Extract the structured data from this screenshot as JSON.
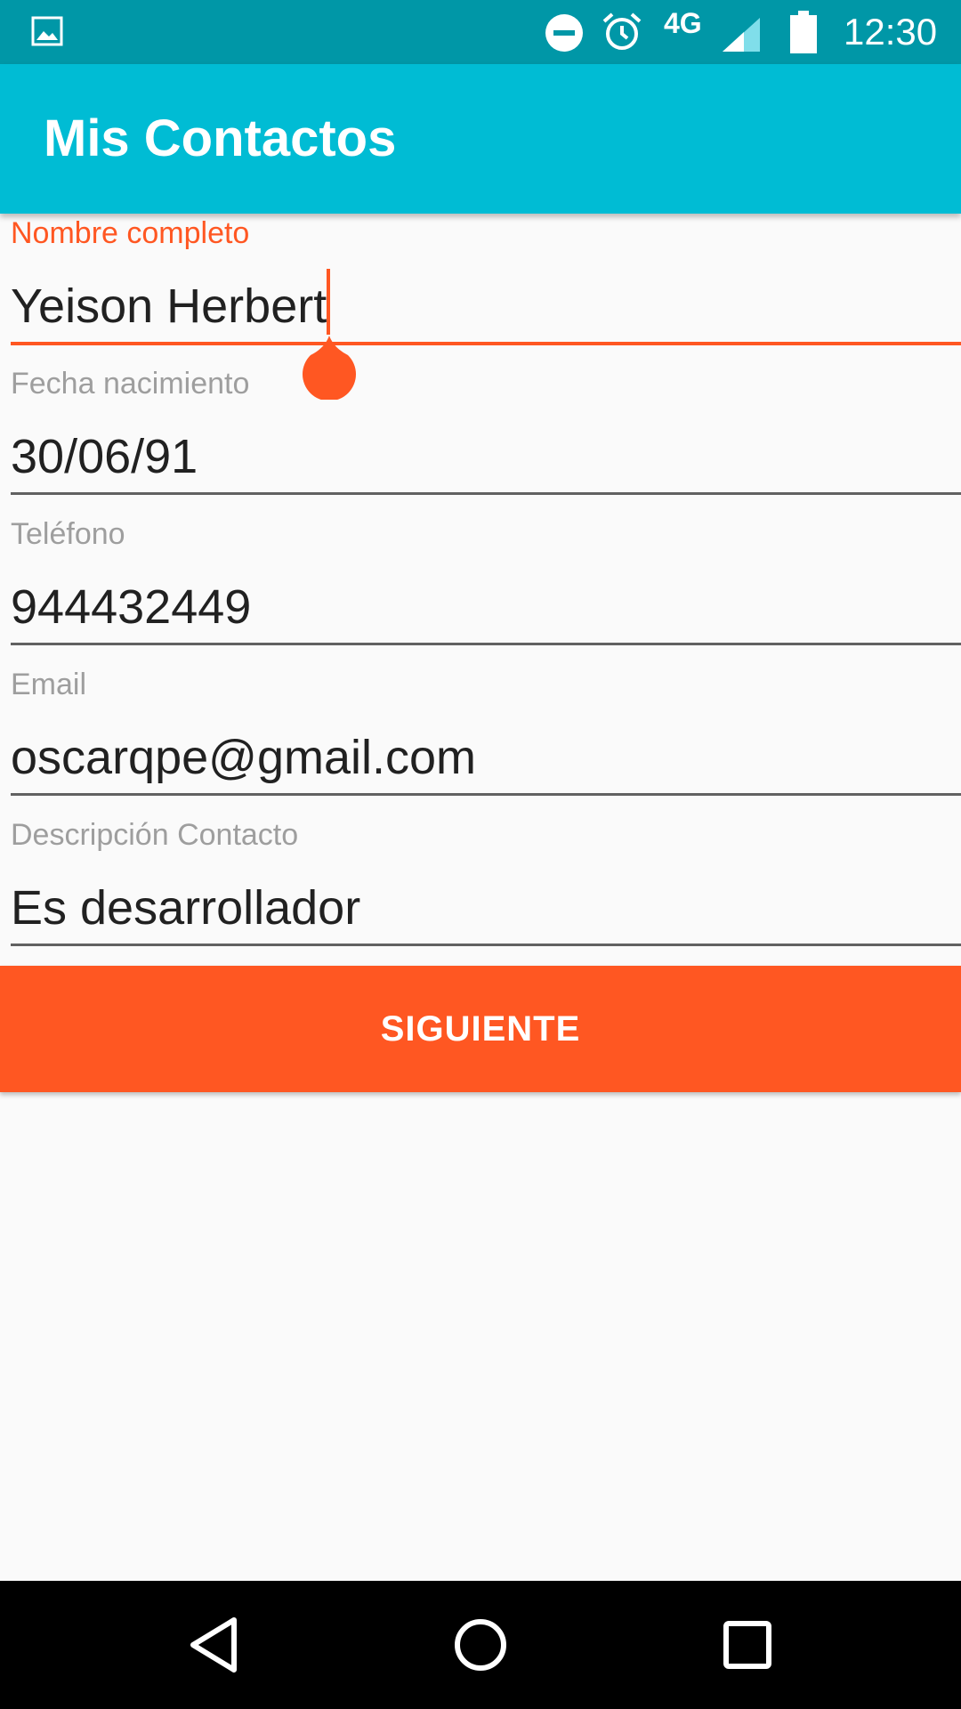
{
  "status_bar": {
    "network": "4G",
    "time": "12:30",
    "icons": [
      "gallery-icon",
      "do-not-disturb-icon",
      "alarm-icon",
      "signal-icon",
      "battery-icon"
    ]
  },
  "app_bar": {
    "title": "Mis Contactos"
  },
  "form": {
    "fields": [
      {
        "label": "Nombre completo",
        "value": "Yeison Herbert"
      },
      {
        "label": "Fecha nacimiento",
        "value": "30/06/91"
      },
      {
        "label": "Teléfono",
        "value": "944432449"
      },
      {
        "label": "Email",
        "value": "oscarqpe@gmail.com"
      },
      {
        "label": "Descripción Contacto",
        "value": "Es desarrollador"
      }
    ],
    "next_label": "SIGUIENTE"
  },
  "nav_bar": {
    "icons": [
      "back-icon",
      "home-icon",
      "recents-icon"
    ]
  },
  "colors": {
    "status_bar": "#0097a7",
    "app_bar": "#00bcd4",
    "accent": "#ff5722",
    "background": "#fafafa"
  }
}
